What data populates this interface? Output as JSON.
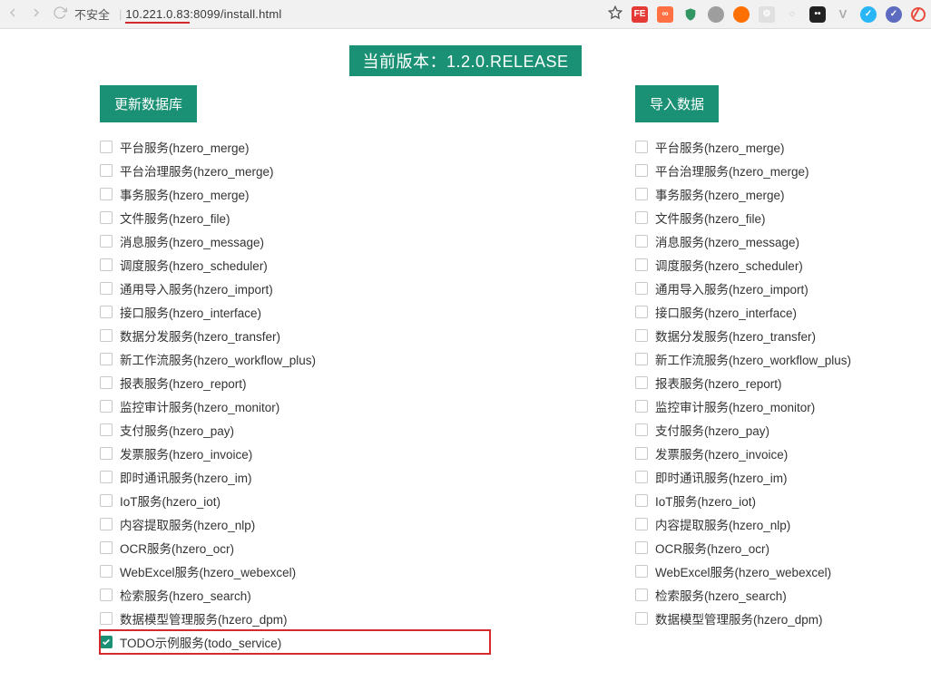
{
  "address_bar": {
    "insecure_label": "不安全",
    "url_highlight": "10.221.0.83",
    "url_rest": ":8099/install.html"
  },
  "banner": {
    "prefix": "当前版本：",
    "version": "1.2.0.RELEASE"
  },
  "left": {
    "button": "更新数据库",
    "items": [
      {
        "label": "平台服务(hzero_merge)",
        "checked": false
      },
      {
        "label": "平台治理服务(hzero_merge)",
        "checked": false
      },
      {
        "label": "事务服务(hzero_merge)",
        "checked": false
      },
      {
        "label": "文件服务(hzero_file)",
        "checked": false
      },
      {
        "label": "消息服务(hzero_message)",
        "checked": false
      },
      {
        "label": "调度服务(hzero_scheduler)",
        "checked": false
      },
      {
        "label": "通用导入服务(hzero_import)",
        "checked": false
      },
      {
        "label": "接口服务(hzero_interface)",
        "checked": false
      },
      {
        "label": "数据分发服务(hzero_transfer)",
        "checked": false
      },
      {
        "label": "新工作流服务(hzero_workflow_plus)",
        "checked": false
      },
      {
        "label": "报表服务(hzero_report)",
        "checked": false
      },
      {
        "label": "监控审计服务(hzero_monitor)",
        "checked": false
      },
      {
        "label": "支付服务(hzero_pay)",
        "checked": false
      },
      {
        "label": "发票服务(hzero_invoice)",
        "checked": false
      },
      {
        "label": "即时通讯服务(hzero_im)",
        "checked": false
      },
      {
        "label": "IoT服务(hzero_iot)",
        "checked": false
      },
      {
        "label": "内容提取服务(hzero_nlp)",
        "checked": false
      },
      {
        "label": "OCR服务(hzero_ocr)",
        "checked": false
      },
      {
        "label": "WebExcel服务(hzero_webexcel)",
        "checked": false
      },
      {
        "label": "检索服务(hzero_search)",
        "checked": false
      },
      {
        "label": "数据模型管理服务(hzero_dpm)",
        "checked": false
      },
      {
        "label": "TODO示例服务(todo_service)",
        "checked": true,
        "highlight": true
      }
    ]
  },
  "right": {
    "button": "导入数据",
    "items": [
      {
        "label": "平台服务(hzero_merge)",
        "checked": false
      },
      {
        "label": "平台治理服务(hzero_merge)",
        "checked": false
      },
      {
        "label": "事务服务(hzero_merge)",
        "checked": false
      },
      {
        "label": "文件服务(hzero_file)",
        "checked": false
      },
      {
        "label": "消息服务(hzero_message)",
        "checked": false
      },
      {
        "label": "调度服务(hzero_scheduler)",
        "checked": false
      },
      {
        "label": "通用导入服务(hzero_import)",
        "checked": false
      },
      {
        "label": "接口服务(hzero_interface)",
        "checked": false
      },
      {
        "label": "数据分发服务(hzero_transfer)",
        "checked": false
      },
      {
        "label": "新工作流服务(hzero_workflow_plus)",
        "checked": false
      },
      {
        "label": "报表服务(hzero_report)",
        "checked": false
      },
      {
        "label": "监控审计服务(hzero_monitor)",
        "checked": false
      },
      {
        "label": "支付服务(hzero_pay)",
        "checked": false
      },
      {
        "label": "发票服务(hzero_invoice)",
        "checked": false
      },
      {
        "label": "即时通讯服务(hzero_im)",
        "checked": false
      },
      {
        "label": "IoT服务(hzero_iot)",
        "checked": false
      },
      {
        "label": "内容提取服务(hzero_nlp)",
        "checked": false
      },
      {
        "label": "OCR服务(hzero_ocr)",
        "checked": false
      },
      {
        "label": "WebExcel服务(hzero_webexcel)",
        "checked": false
      },
      {
        "label": "检索服务(hzero_search)",
        "checked": false
      },
      {
        "label": "数据模型管理服务(hzero_dpm)",
        "checked": false
      }
    ]
  }
}
